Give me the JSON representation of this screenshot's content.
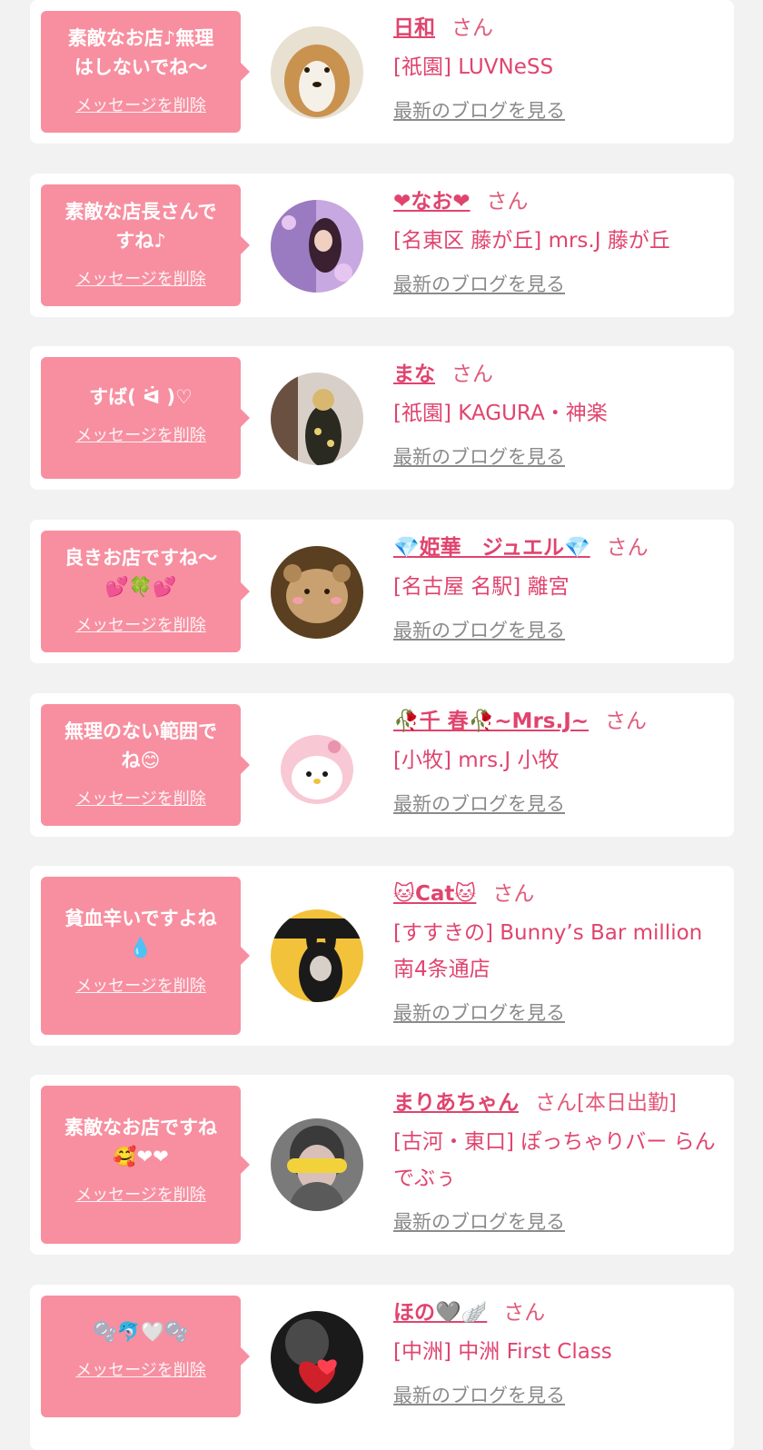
{
  "items": [
    {
      "message": "素敵なお店♪無理\nはしないでね〜",
      "delete_label": "メッセージを削除",
      "name": "日和",
      "honorific": "さん",
      "shop": "[祇園] LUVNeSS",
      "blog_label": "最新のブログを見る",
      "avatar_colors": [
        "#d6a86a",
        "#f4efe6",
        "#7a5a3a"
      ]
    },
    {
      "message": "素敵な店長さんで\nすね♪",
      "delete_label": "メッセージを削除",
      "name": "❤なお❤",
      "honorific": "さん",
      "shop": "[名東区 藤が丘] mrs.J 藤が丘",
      "blog_label": "最新のブログを見る",
      "avatar_colors": [
        "#b58ad6",
        "#5a3a6a",
        "#e6c6f0"
      ]
    },
    {
      "message": "すば( ᐛ )♡",
      "delete_label": "メッセージを削除",
      "name": "まな",
      "honorific": "さん",
      "shop": "[祇園] KAGURA・神楽",
      "blog_label": "最新のブログを見る",
      "avatar_colors": [
        "#6a5a4a",
        "#d8c89a",
        "#2a2a2a"
      ]
    },
    {
      "message": "良きお店ですね〜\n💕🍀💕",
      "delete_label": "メッセージを削除",
      "name": "💎姫華　ジュエル💎",
      "honorific": "さん",
      "shop": "[名古屋 名駅] 離宮",
      "blog_label": "最新のブログを見る",
      "avatar_colors": [
        "#8a6a3a",
        "#c8a070",
        "#3a2a1a"
      ]
    },
    {
      "message": "無理のない範囲で\nね😊",
      "delete_label": "メッセージを削除",
      "name": "🥀千 春🥀~Mrs.J~",
      "honorific": "さん",
      "shop": "[小牧] mrs.J 小牧",
      "blog_label": "最新のブログを見る",
      "avatar_colors": [
        "#ffffff",
        "#f7c6d2",
        "#e894ac"
      ]
    },
    {
      "message": "貧血辛いですよね\n💧",
      "delete_label": "メッセージを削除",
      "name": "🐱Cat🐱",
      "honorific": "さん",
      "shop": "[すすきの] Bunny’s Bar million 南4条通店",
      "blog_label": "最新のブログを見る",
      "avatar_colors": [
        "#f2c23a",
        "#1a1a1a",
        "#d99a2a"
      ]
    },
    {
      "message": "素敵なお店ですね\n🥰❤❤",
      "delete_label": "メッセージを削除",
      "name": "まりあちゃん",
      "honorific": "さん[本日出勤]",
      "shop": "[古河・東口] ぽっちゃりバー らんでぶぅ",
      "blog_label": "最新のブログを見る",
      "avatar_colors": [
        "#8a8a8a",
        "#3a3a3a",
        "#f2d23a"
      ]
    },
    {
      "message": "🫧🐬🤍🫧",
      "delete_label": "メッセージを削除",
      "name": "ほの🩶🪽",
      "honorific": "さん",
      "shop": "[中洲] 中洲 First Class",
      "blog_label": "最新のブログを見る",
      "avatar_colors": [
        "#1a1a1a",
        "#d0202a",
        "#5a5a5a"
      ]
    }
  ]
}
